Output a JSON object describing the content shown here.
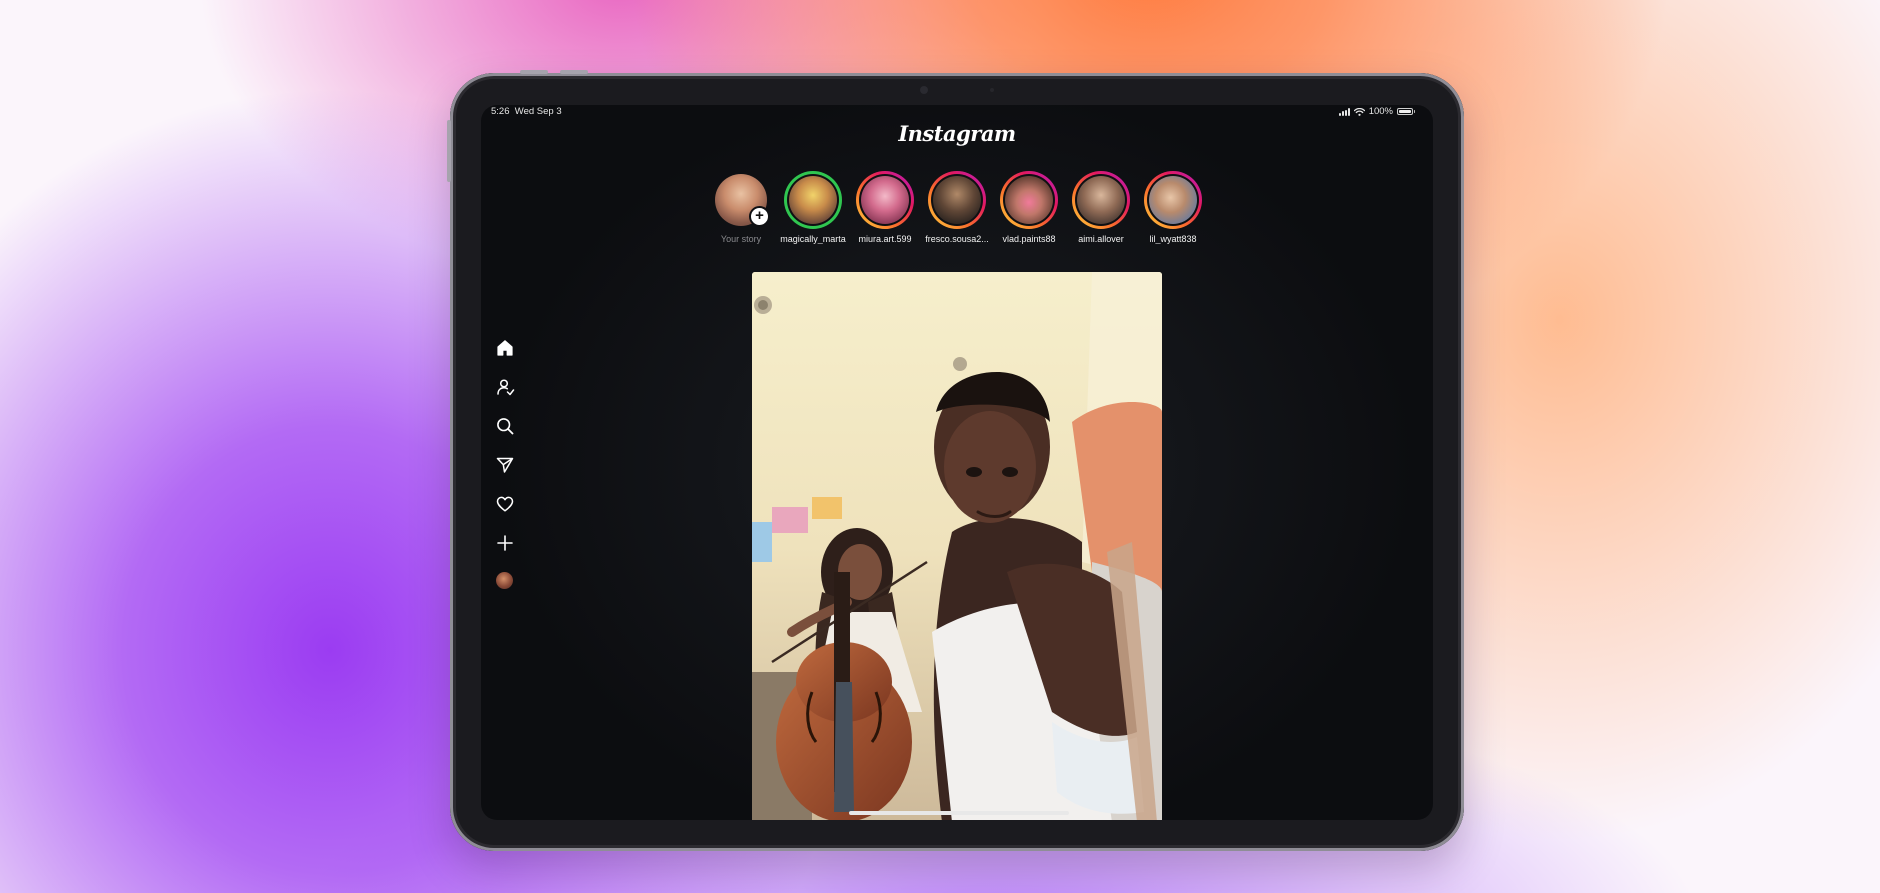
{
  "status_bar": {
    "time": "5:26",
    "date": "Wed Sep 3",
    "battery": "100%"
  },
  "app": {
    "logo": "Instagram"
  },
  "stories": [
    {
      "username": "Your story",
      "ring": "none",
      "is_own": true
    },
    {
      "username": "magically_marta",
      "ring": "green"
    },
    {
      "username": "miura.art.599",
      "ring": "gradient"
    },
    {
      "username": "fresco.sousa2...",
      "ring": "gradient"
    },
    {
      "username": "vlad.paints88",
      "ring": "gradient"
    },
    {
      "username": "aimi.allover",
      "ring": "gradient"
    },
    {
      "username": "lil_wyatt838",
      "ring": "gradient"
    }
  ],
  "sidebar": [
    {
      "icon": "home-icon"
    },
    {
      "icon": "people-icon"
    },
    {
      "icon": "search-icon"
    },
    {
      "icon": "send-icon"
    },
    {
      "icon": "heart-icon"
    },
    {
      "icon": "plus-icon"
    },
    {
      "icon": "profile-avatar"
    }
  ],
  "post": {
    "media": "photo of a person playing cello with another person in the foreground"
  },
  "colors": {
    "close_friends_ring": "#30c650",
    "story_gradient": [
      "#ffd23e",
      "#fa6d2c",
      "#e3195f",
      "#b41fc4"
    ],
    "screen_bg": "#0c0d10"
  }
}
